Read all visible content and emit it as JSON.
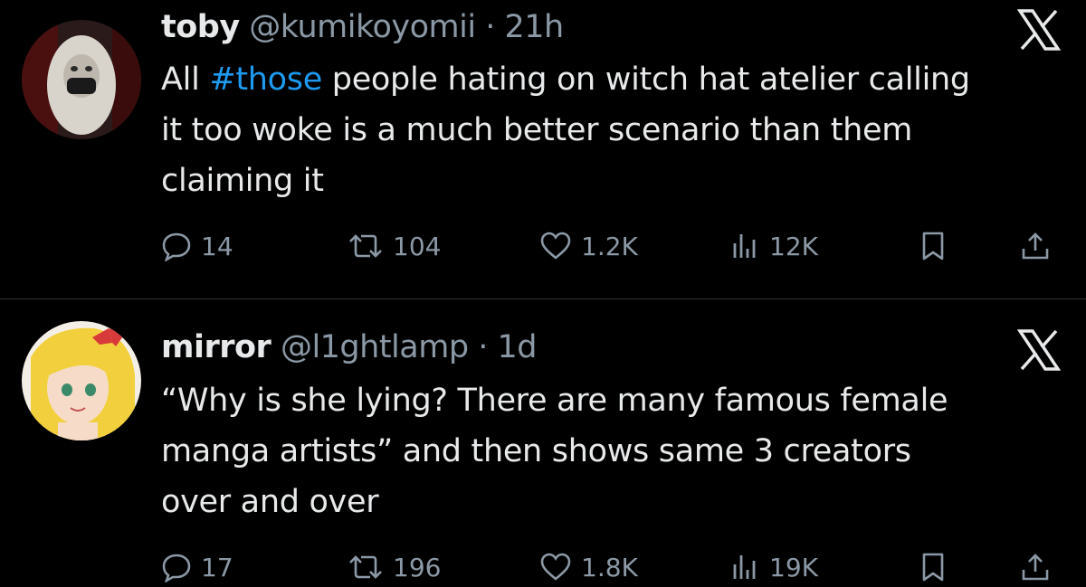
{
  "tweets": [
    {
      "name": "toby",
      "handle": "@kumikoyomii",
      "separator": "·",
      "time": "21h",
      "text_before": "All ",
      "hashtag": "#those",
      "line1_rest": " people hating on witch hat atelier calling",
      "line2": "it too woke is a much better scenario than them",
      "line3": "claiming it",
      "replies": "14",
      "reposts": "104",
      "likes": "1.2K",
      "views": "12K"
    },
    {
      "name": "mirror",
      "handle": "@l1ghtlamp",
      "separator": "·",
      "time": "1d",
      "line1": "“Why is she lying? There are many famous female",
      "line2": "manga artists” and then shows same 3 creators",
      "line3": "over and over",
      "replies": "17",
      "reposts": "196",
      "likes": "1.8K",
      "views": "19K"
    }
  ],
  "icons": {
    "reply": "speech-bubble-icon",
    "repost": "repost-arrows-icon",
    "like": "heart-icon",
    "views": "bar-chart-icon",
    "bookmark": "bookmark-icon",
    "share": "share-upload-icon",
    "platform": "x-logo-icon"
  },
  "colors": {
    "background": "#000000",
    "text": "#e7e9ea",
    "muted": "#8b98a5",
    "link": "#1d9bf0",
    "divider": "#2f3336"
  }
}
